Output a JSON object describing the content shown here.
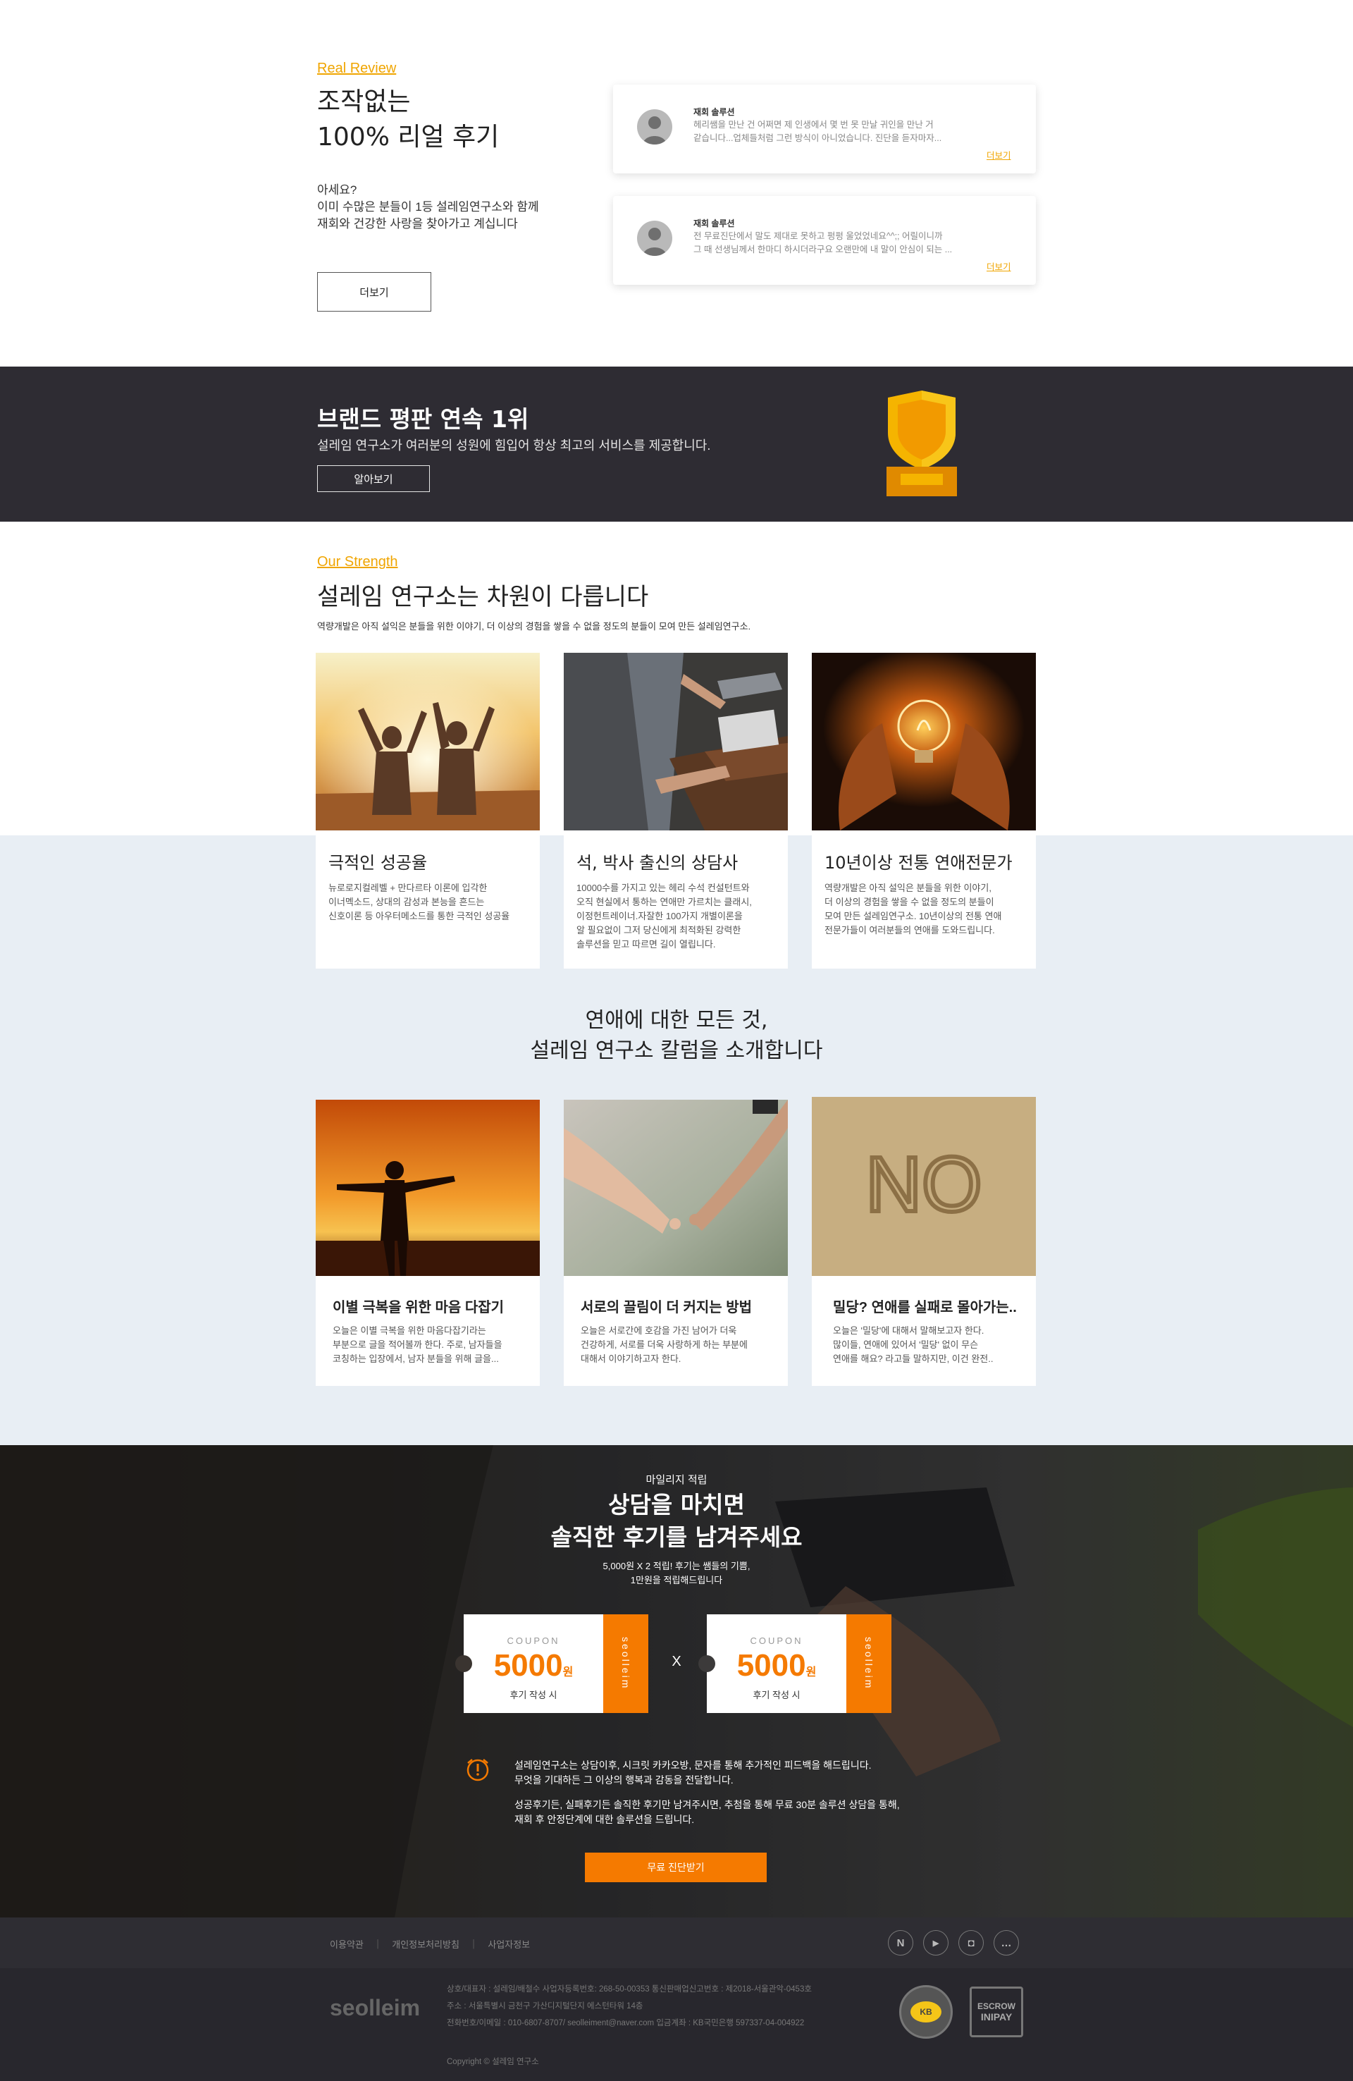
{
  "review": {
    "eyebrow": "Real Review",
    "title_line1": "조작없는",
    "title_line2": "100% 리얼 후기",
    "desc_line1": "아세요?",
    "desc_line2": "이미 수많은 분들이 1등 설레임연구소와 함께",
    "desc_line3": "재회와 건강한 사랑을 찾아가고 계십니다",
    "more_button": "더보기",
    "cards": [
      {
        "name": "재회 솔루션",
        "line1": "헤리쌤을 만난 건 어쩌면 제 인생에서 몇 번 못 만날 귀인을 만난 거",
        "line2": "같습니다...업체들처럼 그런 방식이 아니었습니다. 진단을 듣자마자...",
        "more": "더보기"
      },
      {
        "name": "재회 솔루션",
        "line1": "전 무료진단에서 말도 제대로 못하고 펑펑 울었었네요^^;; 어릴이니까",
        "line2": "그 때 선생님께서 한마디 하시더라구요 오랜만에 내 말이 안심이 되는 ...",
        "more": "더보기"
      }
    ]
  },
  "banner": {
    "title": "브랜드 평판 연속 1위",
    "subtitle": "설레임 연구소가 여러분의 성원에 힘입어 항상 최고의 서비스를 제공합니다.",
    "button": "알아보기",
    "trophy_icon": "trophy-icon"
  },
  "strength": {
    "eyebrow": "Our Strength",
    "title": "설레임 연구소는 차원이 다릅니다",
    "subtitle": "역량개발은 아직 설익은 분들을 위한 이야기, 더 이상의 경험을 쌓을 수 없을 정도의 분들이 모여 만든 설레임연구소.",
    "cards": [
      {
        "title": "극적인 성공율",
        "lines": [
          "뉴로로지컬레벨 + 만다르타 이론에 입각한",
          "이너멕소드, 상대의 감성과 본능을 흔드는",
          "신호이론 등 아우터메소드를 통한 극적인 성공율"
        ]
      },
      {
        "title": "석, 박사 출신의 상담사",
        "lines": [
          "10000수를 가지고 있는 헤리 수석 컨설턴트와",
          "오직 현실에서 통하는 연애만 가르치는 클래시,",
          "이정헌트레이너.자잘한 100가지 개별이론을",
          "알 필요없이 그저 당신에게 최적화된 강력한",
          "솔루션을 믿고 따르면 길이 열립니다."
        ]
      },
      {
        "title": "10년이상 전통 연애전문가",
        "lines": [
          "역량개발은 아직 설익은 분들을 위한 이야기,",
          "더 이상의 경험을 쌓을 수 없을 정도의 분들이",
          "모여 만든 설레임연구소. 10년이상의 전통 연애",
          "전문가들이 여러분들의 연애를 도와드립니다."
        ]
      }
    ]
  },
  "column": {
    "title_line1": "연애에 대한 모든 것,",
    "title_line2": "설레임 연구소 칼럼을 소개합니다",
    "cards": [
      {
        "title": "이별 극복을 위한 마음 다잡기",
        "lines": [
          "오늘은 이별 극복을 위한 마음다잡기라는",
          "부분으로 글을 적어볼까 한다. 주로, 남자들을",
          "코칭하는 입장에서, 남자 분들을 위해 글을..."
        ]
      },
      {
        "title": "서로의 끌림이 더 커지는 방법",
        "lines": [
          "오늘은 서로간에 호감을 가진 남어가 더욱",
          "건강하게, 서로를 더욱 사랑하게 하는 부분에",
          "대해서 이야기하고자 한다."
        ]
      },
      {
        "title": "밀당? 연애를 실패로 몰아가는..",
        "lines": [
          "오늘은 '밀당'에 대해서 말해보고자 한다.",
          "많이들, 연애에 있어서 '밀당' 없이 무슨",
          "연애를 해요? 라고들 말하지만, 이건 완전.."
        ]
      }
    ],
    "sand_word": "NO"
  },
  "coupon": {
    "eyebrow": "마일리지 적립",
    "title_line1": "상담을 마치면",
    "title_line2": "솔직한 후기를 남겨주세요",
    "desc_line1": "5,000원 X 2 적립! 후기는 쌤들의 기쁨,",
    "desc_line2": "1만원을 적립해드립니다",
    "coupon_label": "COUPON",
    "amount": "5000",
    "won": "원",
    "condition": "후기 작성 시",
    "brand_vertical": "seolleim",
    "multiply": "X",
    "notice_line1": "설레임연구소는 상담이후, 시크릿 카카오방, 문자를 통해 추가적인 피드백을 해드립니다.",
    "notice_line2": "무엇을 기대하든 그 이상의 행복과 감동을 전달합니다.",
    "notice_line3": "성공후기든, 실패후기든 솔직한 후기만 남겨주시면, 추첨을 통해 무료 30분 솔루션 상담을 통해,",
    "notice_line4": "재회 후 안정단계에 대한 솔루션을 드립니다.",
    "cta": "무료 진단받기",
    "notice_icon": "alert-clock-icon"
  },
  "footer": {
    "links": [
      "이용약관",
      "개인정보처리방침",
      "사업자정보"
    ],
    "sns": [
      {
        "icon": "naver-blog-icon",
        "glyph": "N"
      },
      {
        "icon": "youtube-icon",
        "glyph": "▶"
      },
      {
        "icon": "instagram-icon",
        "glyph": "◘"
      },
      {
        "icon": "kakao-talk-icon",
        "glyph": "…"
      }
    ],
    "logo": "seolleim",
    "info_line1": "상호/대표자 : 설레임/배철수     사업자등록번호: 268-50-00353     통신판매업신고번호 : 제2018-서울관악-0453호",
    "info_line2": "주소 : 서울특별시 금천구 가산디지털단지 에스턴타워 14층",
    "info_line3": "전화번호/이메일 : 010-6807-8707/ seolleiment@naver.com     입금계좌 : KB국민은행 597337-04-004922",
    "copyright": "Copyright © 설레임 연구소",
    "escrow_line1": "ESCROW",
    "escrow_line2": "INIPAY",
    "kb_badge": "KB"
  },
  "colors": {
    "accent": "#f57a00",
    "eyebrow": "#f0a500",
    "dark": "#2e2c33",
    "light_bg": "#e8eef4"
  }
}
